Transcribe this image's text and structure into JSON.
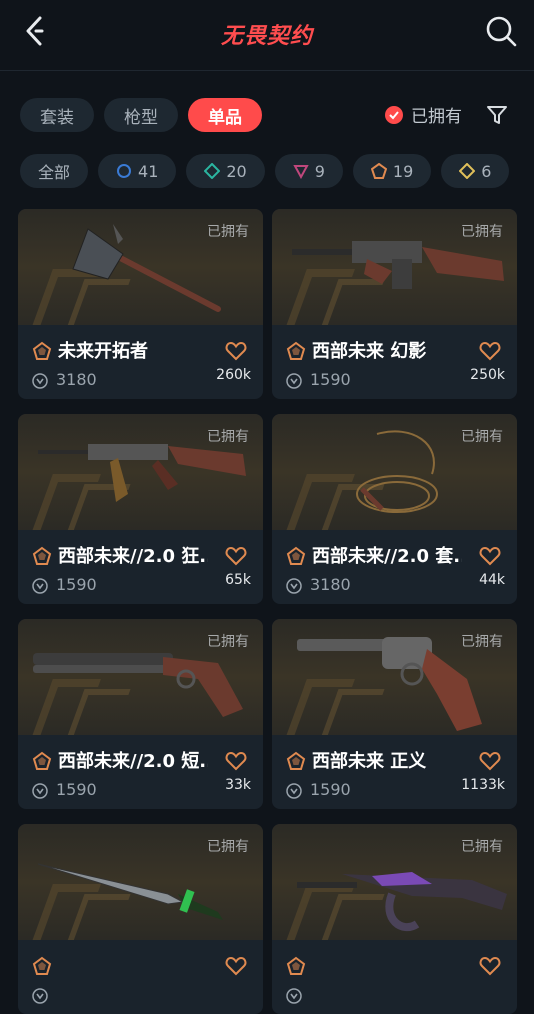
{
  "header": {
    "title": "无畏契约",
    "back_icon": "chevron-left-icon",
    "search_icon": "search-icon"
  },
  "tabs": [
    {
      "label": "套装",
      "active": false
    },
    {
      "label": "枪型",
      "active": false
    },
    {
      "label": "单品",
      "active": true
    }
  ],
  "owned_filter": {
    "label": "已拥有",
    "checked": true,
    "accent": "#ff4b4b"
  },
  "filter_icon": "filter-icon",
  "rarity_chips": [
    {
      "label": "全部"
    },
    {
      "label": "41",
      "color": "#3a7bd5",
      "shape": "circle"
    },
    {
      "label": "20",
      "color": "#2bb5a0",
      "shape": "diamond"
    },
    {
      "label": "9",
      "color": "#c0477c",
      "shape": "triangle"
    },
    {
      "label": "19",
      "color": "#e08a50",
      "shape": "pentagon"
    },
    {
      "label": "6",
      "color": "#e0c05a",
      "shape": "diamond"
    }
  ],
  "cards": [
    {
      "owned_tag": "已拥有",
      "name": "未来开拓者",
      "price": "3180",
      "likes": "260k",
      "weapon": "axe"
    },
    {
      "owned_tag": "已拥有",
      "name": "西部未来 幻影",
      "price": "1590",
      "likes": "250k",
      "weapon": "rifle-suppressed"
    },
    {
      "owned_tag": "已拥有",
      "name": "西部未来//2.0 狂...",
      "price": "1590",
      "likes": "65k",
      "weapon": "rifle"
    },
    {
      "owned_tag": "已拥有",
      "name": "西部未来//2.0 套...",
      "price": "3180",
      "likes": "44k",
      "weapon": "lasso"
    },
    {
      "owned_tag": "已拥有",
      "name": "西部未来//2.0 短...",
      "price": "1590",
      "likes": "33k",
      "weapon": "shotgun"
    },
    {
      "owned_tag": "已拥有",
      "name": "西部未来 正义",
      "price": "1590",
      "likes": "1133k",
      "weapon": "revolver"
    },
    {
      "owned_tag": "已拥有",
      "name": "",
      "price": "",
      "likes": "",
      "weapon": "knife"
    },
    {
      "owned_tag": "已拥有",
      "name": "",
      "price": "",
      "likes": "",
      "weapon": "rifle-purple"
    }
  ]
}
